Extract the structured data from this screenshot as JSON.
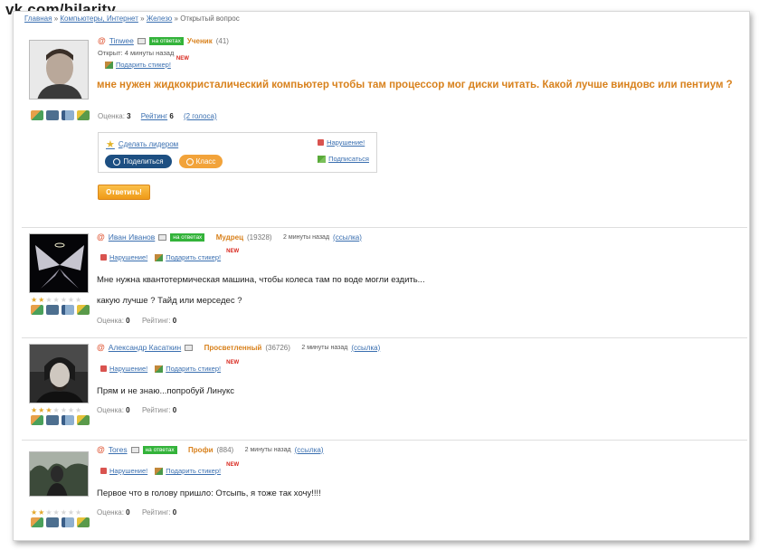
{
  "watermark": "vk.com/hilarity",
  "breadcrumbs": {
    "home": "Главная",
    "sep": "»",
    "category": "Компьютеры, Интернет",
    "subcategory": "Железо",
    "current": "Открытый вопрос"
  },
  "question": {
    "author": "Tinwee",
    "online_badge": "на ответах",
    "rank": "Ученик",
    "points": "(41)",
    "opened": "Открыт: 4 минуты назад",
    "gift_label": "Подарить стикер!",
    "new_badge": "NEW",
    "text": "мне нужен жидкокристалический компьютер чтобы там процессор мог диски читать. Какой лучше виндовс или пентиум ?",
    "score_label": "Оценка:",
    "score_value": "3",
    "rating_label": "Рейтинг",
    "rating_value": "6",
    "votes": "(2 голоса)",
    "make_leader": "Сделать лидером",
    "share_button": "Поделиться",
    "class_button": "Класс",
    "violation": "Нарушение!",
    "subscribe": "Подписаться",
    "answer_button": "Ответить!"
  },
  "answers": [
    {
      "author": "Иван Иванов",
      "online_badge": "на ответах",
      "rank": "Мудрец",
      "points": "(19328)",
      "time": "2 минуты назад",
      "link": "(ссылка)",
      "violation": "Нарушение!",
      "gift_label": "Подарить стикер!",
      "new_badge": "NEW",
      "text_line1": "Мне нужна квантотермическая машина, чтобы колеса там по воде могли ездить...",
      "text_line2": "какую лучше ? Тайд или мерседес ?",
      "score_label": "Оценка:",
      "score_value": "0",
      "rating_label": "Рейтинг:",
      "rating_value": "0",
      "stars": 2
    },
    {
      "author": "Александр Касаткин",
      "rank": "Просветленный",
      "points": "(36726)",
      "time": "2 минуты назад",
      "link": "(ссылка)",
      "violation": "Нарушение!",
      "gift_label": "Подарить стикер!",
      "new_badge": "NEW",
      "text_line1": "Прям и не знаю...попробуй Линукс",
      "score_label": "Оценка:",
      "score_value": "0",
      "rating_label": "Рейтинг:",
      "rating_value": "0",
      "stars": 3
    },
    {
      "author": "Tores",
      "online_badge": "на ответах",
      "rank": "Профи",
      "points": "(884)",
      "time": "2 минуты назад",
      "link": "(ссылка)",
      "violation": "Нарушение!",
      "gift_label": "Подарить стикер!",
      "new_badge": "NEW",
      "text_line1": "Первое что в голову пришло: Отсыпь, я тоже так хочу!!!!",
      "score_label": "Оценка:",
      "score_value": "0",
      "rating_label": "Рейтинг:",
      "rating_value": "0",
      "stars": 2
    }
  ],
  "colors": {
    "link": "#3a6fb0",
    "rank_orange": "#d8811c",
    "online_green": "#33b33a",
    "share_blue": "#1d4f82",
    "class_orange": "#f2a33a"
  }
}
